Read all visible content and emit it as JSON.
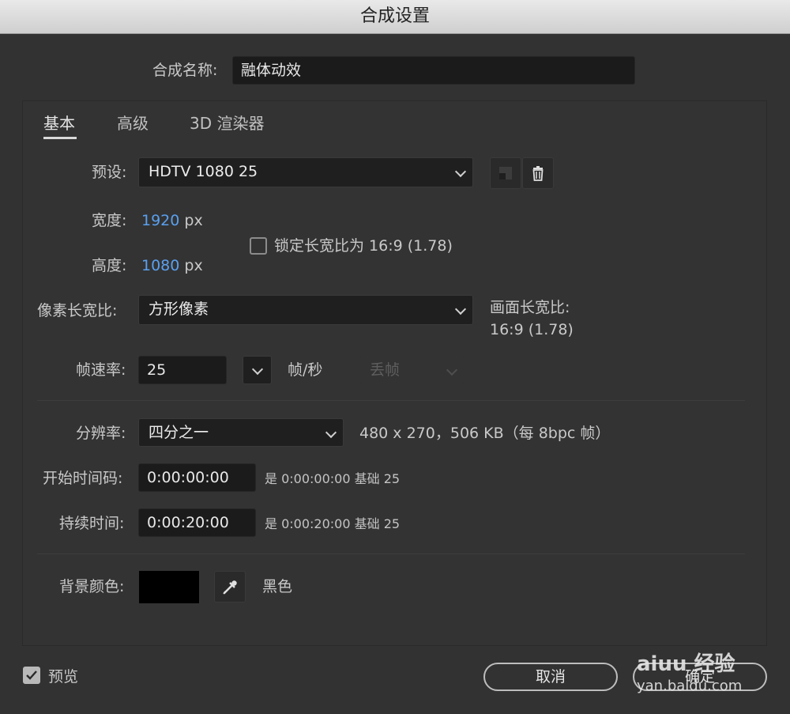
{
  "window": {
    "title": "合成设置"
  },
  "comp_name": {
    "label": "合成名称:",
    "value": "融体动效"
  },
  "tabs": [
    {
      "label": "基本"
    },
    {
      "label": "高级"
    },
    {
      "label": "3D 渲染器"
    }
  ],
  "preset": {
    "label": "预设:",
    "value": "HDTV 1080 25"
  },
  "width": {
    "label": "宽度:",
    "value": "1920",
    "unit": "px"
  },
  "height": {
    "label": "高度:",
    "value": "1080",
    "unit": "px"
  },
  "lock_aspect": {
    "label": "锁定长宽比为 16:9 (1.78)",
    "checked": false
  },
  "pixel_aspect": {
    "label": "像素长宽比:",
    "value": "方形像素"
  },
  "frame_aspect": {
    "label": "画面长宽比:",
    "value": "16:9 (1.78)"
  },
  "frame_rate": {
    "label": "帧速率:",
    "value": "25",
    "unit": "帧/秒",
    "drop_frame": "丢帧"
  },
  "resolution": {
    "label": "分辨率:",
    "value": "四分之一",
    "info": "480 x 270，506 KB（每 8bpc 帧）"
  },
  "start_timecode": {
    "label": "开始时间码:",
    "value": "0:00:00:00",
    "info": "是 0:00:00:00  基础 25"
  },
  "duration": {
    "label": "持续时间:",
    "value": "0:00:20:00",
    "info": "是 0:00:20:00  基础 25"
  },
  "background": {
    "label": "背景颜色:",
    "color": "#000000",
    "name": "黑色"
  },
  "preview": {
    "label": "预览",
    "checked": true
  },
  "buttons": {
    "cancel": "取消",
    "ok": "确定"
  },
  "watermark": {
    "line1": "aiuu 经验",
    "line2": "yan.baidu.com"
  }
}
